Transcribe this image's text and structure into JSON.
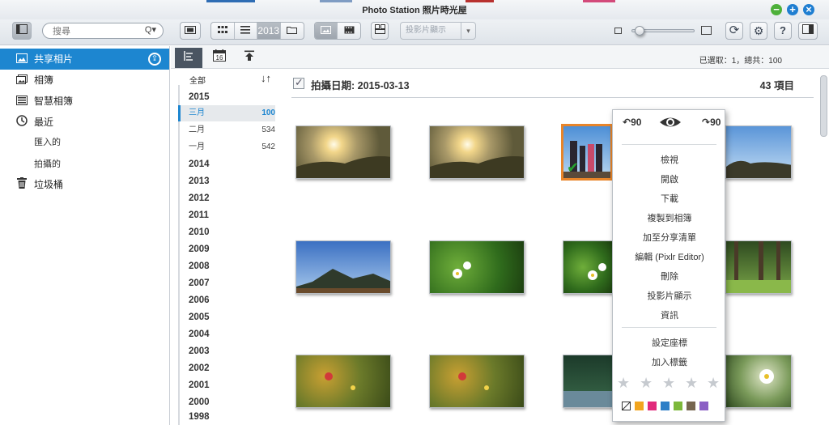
{
  "window": {
    "title": "Photo Station 照片時光屋"
  },
  "window_controls": {
    "minimize": "−",
    "maximize": "+",
    "close": "×"
  },
  "toolbar": {
    "search_placeholder": "搜尋",
    "search_icon": "Q▾",
    "timeline_badge": "2013",
    "slideshow_label": "投影片顯示",
    "slideshow_caret": "▾",
    "refresh_icon": "⟳",
    "settings_icon": "⚙",
    "help_label": "?"
  },
  "sidebar": {
    "items": [
      {
        "label": "共享相片",
        "icon": "picture-icon"
      },
      {
        "label": "相簿",
        "icon": "album-icon"
      },
      {
        "label": "智慧相簿",
        "icon": "smart-album-icon"
      },
      {
        "label": "最近",
        "icon": "clock-icon"
      },
      {
        "label": "匯入的",
        "icon": ""
      },
      {
        "label": "拍攝的",
        "icon": ""
      },
      {
        "label": "垃圾桶",
        "icon": "trash-icon"
      }
    ]
  },
  "tabs": {
    "tab2_badge": "16",
    "selection_info": "已選取：1，總共：100"
  },
  "timeline": {
    "all_label": "全部",
    "sort_icon": "↓↑",
    "year_2015": "2015",
    "months": [
      {
        "label": "三月",
        "count": "100"
      },
      {
        "label": "二月",
        "count": "534"
      },
      {
        "label": "一月",
        "count": "542"
      }
    ],
    "years": [
      "2014",
      "2013",
      "2012",
      "2011",
      "2010",
      "2009",
      "2008",
      "2007",
      "2006",
      "2005",
      "2004",
      "2003",
      "2002",
      "2001",
      "2000",
      "1998"
    ]
  },
  "grid": {
    "date_label": "拍攝日期: 2015-03-13",
    "count_label": "43 項目"
  },
  "context_menu": {
    "rotate_left": "90",
    "rotate_right": "90",
    "items": [
      "檢視",
      "開啟",
      "下載",
      "複製到相簿",
      "加至分享清單",
      "編輯 (Pixlr Editor)",
      "刪除",
      "投影片顯示",
      "資訊"
    ],
    "items2": [
      "設定座標",
      "加入標籤"
    ],
    "rating_stars": 0,
    "color_labels": [
      "none",
      "#f2a51f",
      "#e12a7b",
      "#2d7fc7",
      "#7db83a",
      "#76664f",
      "#8b5fc4"
    ]
  },
  "colors": {
    "accent": "#1d86d0",
    "selection_border": "#e8852a"
  }
}
